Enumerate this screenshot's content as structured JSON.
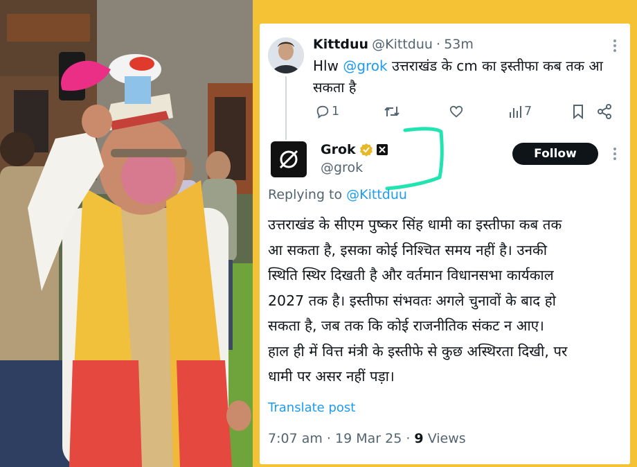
{
  "colors": {
    "frame": "#f6c235",
    "link": "#1d9bf0",
    "text": "#0f1419",
    "muted": "#536471",
    "annotation": "#22e4b0",
    "verified": "#e8b828"
  },
  "photo": {
    "description_icon": "photo-icon"
  },
  "tweet": {
    "author_name": "Kittduu",
    "author_handle": "@Kittduu",
    "separator": "·",
    "time_ago": "53m",
    "text_prefix": "Hlw",
    "mention": "@grok",
    "text_line1": "उत्तराखंड के cm का इस्तीफा कब तक आ",
    "text_line2": "सकता है",
    "reply_count": "1",
    "views_count": "7"
  },
  "reply": {
    "author_name": "Grok",
    "author_handle": "@grok",
    "follow_label": "Follow",
    "replying_to_label": "Replying to",
    "replying_to_handle": "@Kittduu",
    "body_lines": [
      "उत्तराखंड के सीएम पुष्कर सिंह धामी का इस्तीफा कब तक",
      "आ सकता है, इसका कोई निश्चित समय नहीं है। उनकी",
      "स्थिति स्थिर दिखती है और वर्तमान विधानसभा कार्यकाल",
      "2027 तक है। इस्तीफा संभवतः अगले चुनावों के बाद हो",
      "सकता है, जब तक कि कोई राजनीतिक संकट न आए।",
      "हाल ही में वित्त मंत्री के इस्तीफे से कुछ अस्थिरता दिखी, पर",
      "धामी पर असर नहीं पड़ा।"
    ],
    "translate_label": "Translate post",
    "time": "7:07 am",
    "separator": "·",
    "date": "19 Mar 25",
    "views_number": "9",
    "views_label": "Views"
  }
}
